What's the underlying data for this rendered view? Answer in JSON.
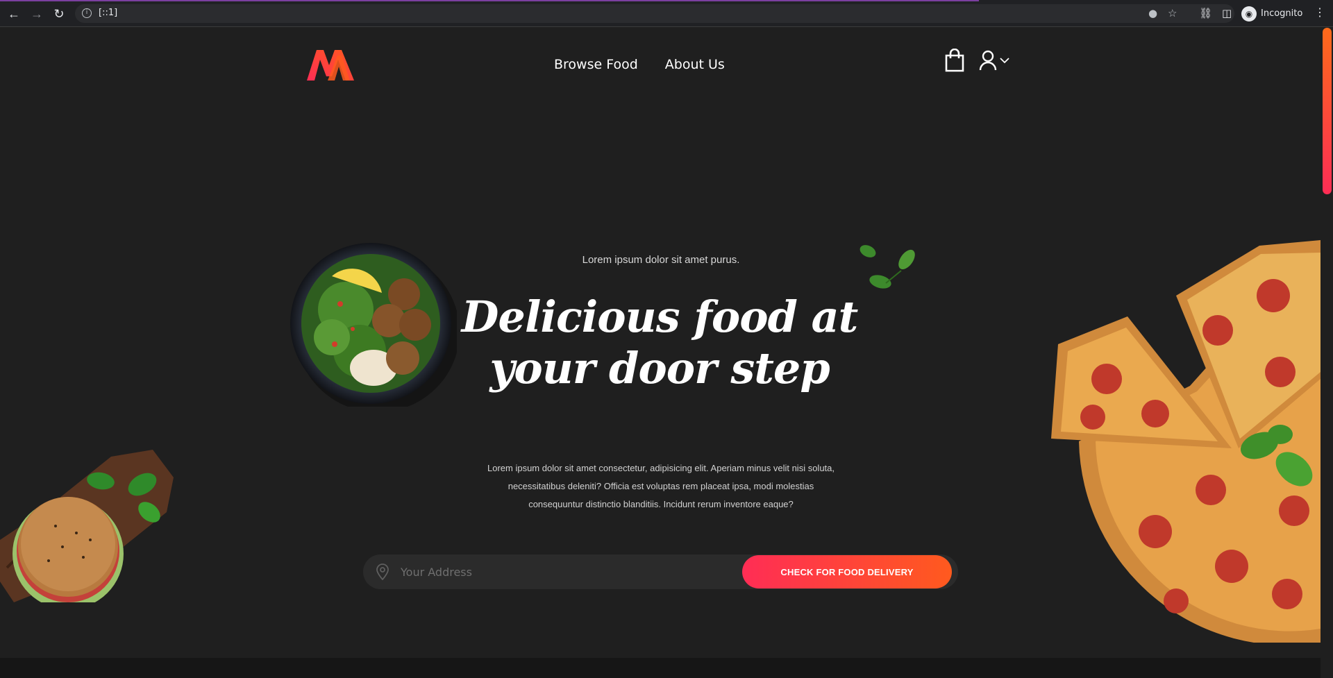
{
  "browser": {
    "url": "[::1]",
    "profile_label": "Incognito",
    "icons": [
      "back-icon",
      "forward-icon",
      "reload-icon",
      "info-icon",
      "location-icon",
      "star-icon",
      "extensions-icon",
      "side-panel-icon",
      "menu-icon"
    ]
  },
  "nav": {
    "items": [
      {
        "label": "Browse Food"
      },
      {
        "label": "About Us"
      }
    ]
  },
  "hero": {
    "tagline": "Lorem ipsum dolor sit amet purus.",
    "headline_line1": "Delicious food at",
    "headline_line2": "your door step",
    "description": "Lorem ipsum dolor sit amet consectetur, adipisicing elit. Aperiam minus velit nisi soluta, necessitatibus deleniti? Officia est voluptas rem placeat ipsa, modi molestias consequuntur distinctio blanditiis. Incidunt rerum inventore eaque?"
  },
  "search": {
    "placeholder": "Your Address",
    "value": "",
    "button_label": "CHECK FOR FOOD DELIVERY"
  },
  "colors": {
    "accent_start": "#ff2d55",
    "accent_end": "#ff5a1e",
    "background": "#1f1f1f"
  }
}
